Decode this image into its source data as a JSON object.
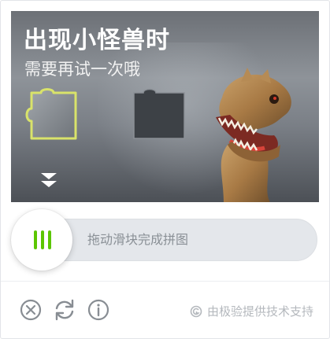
{
  "captcha": {
    "headline": "出现小怪兽时",
    "subline": "需要再试一次哦",
    "icons": {
      "puzzle_piece": "puzzle-piece-icon",
      "puzzle_gap": "puzzle-gap-icon",
      "drag_arrow": "arrow-down-icon",
      "image_subject": "dinosaur"
    }
  },
  "slider": {
    "hint": "拖动滑块完成拼图",
    "knob_icon": "drag-handle-icon",
    "accent_color": "#5cc600"
  },
  "footer": {
    "close_icon": "close-icon",
    "refresh_icon": "refresh-icon",
    "info_icon": "info-icon",
    "brand_icon": "geetest-logo-icon",
    "brand_text": "由极验提供技术支持"
  }
}
